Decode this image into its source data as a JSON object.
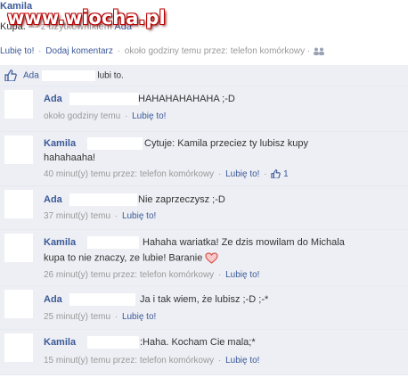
{
  "post": {
    "author": "Kamila",
    "status_start": "Kupa.",
    "status_mid": "— z użytkownikiem",
    "tagged": "Ada",
    "watermark": "www.wiocha.pl",
    "like_action": "Lubię to!",
    "comment_action": "Dodaj komentarz",
    "meta": "około godziny temu przez: telefon komórkowy ·"
  },
  "likes": {
    "name": "Ada",
    "suffix": "lubi to."
  },
  "comments": [
    {
      "author": "Ada",
      "text": "HAHAHAHAHAHA ;-D",
      "time": "około godziny temu",
      "like": "Lubię to!"
    },
    {
      "author": "Kamila",
      "text": "Cytuje: Kamila przeciez ty lubisz kupy",
      "text2": "hahahaaha!",
      "time": "40 minut(y) temu przez: telefon komórkowy",
      "like": "Lubię to!",
      "likes_count": "1"
    },
    {
      "author": "Ada",
      "text": "Nie zaprzeczysz ;-D",
      "time": "37 minut(y) temu",
      "like": "Lubię to!"
    },
    {
      "author": "Kamila",
      "text": "Hahaha wariatka! Ze dzis mowilam do Michala",
      "text2": "kupa to nie znaczy, ze lubie! Baranie",
      "time": "26 minut(y) temu przez: telefon komórkowy",
      "like": "Lubię to!"
    },
    {
      "author": "Ada",
      "text": "Ja i tak wiem, że lubisz ;-D ;-*",
      "time": "25 minut(y) temu",
      "like": "Lubię to!"
    },
    {
      "author": "Kamila",
      "text": ":Haha. Kocham Cie mala;*",
      "time": "15 minut(y) temu przez: telefon komórkowy",
      "like": "Lubię to!"
    }
  ],
  "icons": {
    "people": "people-icon",
    "thumb": "thumbs-up-icon",
    "heart": "heart-emoticon"
  },
  "colors": {
    "link": "#3b5998",
    "comment_bg": "#edeff4",
    "watermark_outline": "#bb0000"
  }
}
